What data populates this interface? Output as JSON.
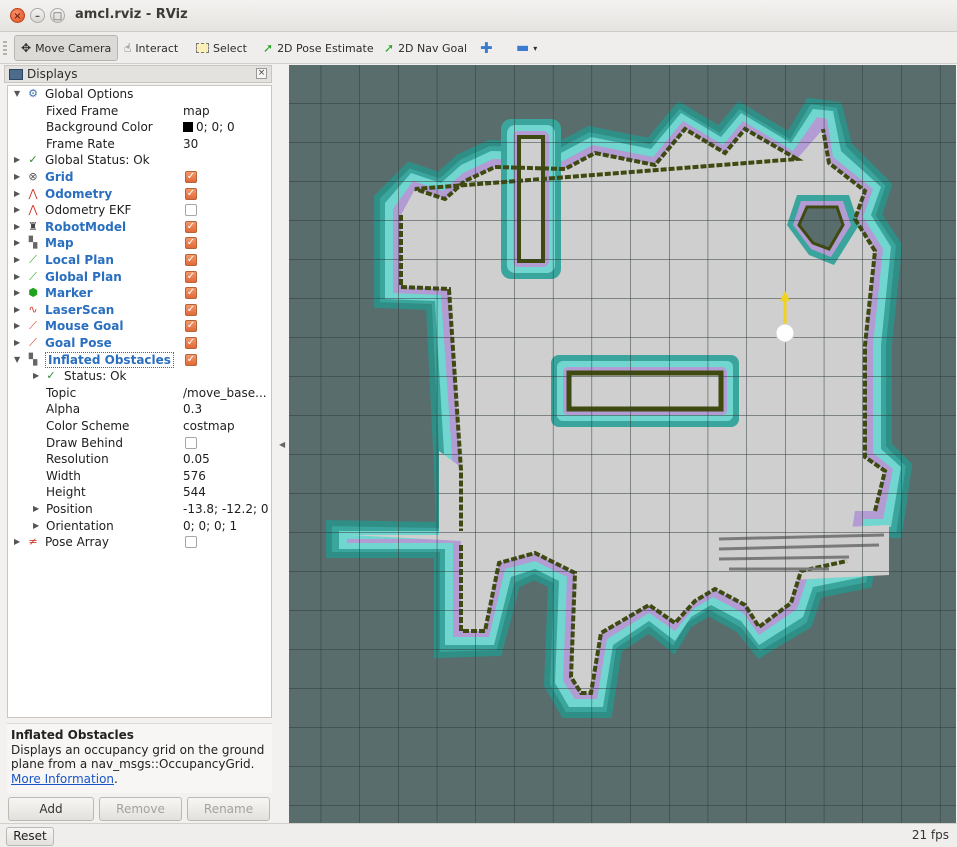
{
  "window": {
    "title": "amcl.rviz - RViz"
  },
  "toolbar": {
    "tools": [
      {
        "label": "Move Camera",
        "icon": "move-camera-icon"
      },
      {
        "label": "Interact",
        "icon": "hand-icon"
      },
      {
        "label": "Select",
        "icon": "select-icon"
      },
      {
        "label": "2D Pose Estimate",
        "icon": "pose-arrow-icon"
      },
      {
        "label": "2D Nav Goal",
        "icon": "goal-arrow-icon"
      }
    ]
  },
  "displays": {
    "title": "Displays",
    "rows": [
      {
        "label": "Global Options"
      },
      {
        "label": "Fixed Frame",
        "value": "map"
      },
      {
        "label": "Background Color",
        "value": "0; 0; 0"
      },
      {
        "label": "Frame Rate",
        "value": "30"
      },
      {
        "label": "Global Status: Ok"
      },
      {
        "label": "Grid",
        "checked": true
      },
      {
        "label": "Odometry",
        "checked": true
      },
      {
        "label": "Odometry EKF",
        "checked": false
      },
      {
        "label": "RobotModel",
        "checked": true
      },
      {
        "label": "Map",
        "checked": true
      },
      {
        "label": "Local Plan",
        "checked": true
      },
      {
        "label": "Global Plan",
        "checked": true
      },
      {
        "label": "Marker",
        "checked": true
      },
      {
        "label": "LaserScan",
        "checked": true
      },
      {
        "label": "Mouse Goal",
        "checked": true
      },
      {
        "label": "Goal Pose",
        "checked": true
      },
      {
        "label": "Inflated Obstacles",
        "checked": true
      },
      {
        "label": "Status: Ok"
      },
      {
        "label": "Topic",
        "value": "/move_base..."
      },
      {
        "label": "Alpha",
        "value": "0.3"
      },
      {
        "label": "Color Scheme",
        "value": "costmap"
      },
      {
        "label": "Draw Behind",
        "checked": false
      },
      {
        "label": "Resolution",
        "value": "0.05"
      },
      {
        "label": "Width",
        "value": "576"
      },
      {
        "label": "Height",
        "value": "544"
      },
      {
        "label": "Position",
        "value": "-13.8; -12.2; 0"
      },
      {
        "label": "Orientation",
        "value": "0; 0; 0; 1"
      },
      {
        "label": "Pose Array",
        "checked": false
      }
    ]
  },
  "description": {
    "title": "Inflated Obstacles",
    "text": "Displays an occupancy grid on the ground plane from a nav_msgs::OccupancyGrid.",
    "link": "More Information",
    "after_link": "."
  },
  "buttons": {
    "add": "Add",
    "remove": "Remove",
    "rename": "Rename"
  },
  "status": {
    "reset": "Reset",
    "fps": "21 fps"
  },
  "colors": {
    "view_background": "#5a6d6d",
    "free_space": "#cfcfcf",
    "wall": "#3f4a10",
    "inflation_inner": "#b39bd3",
    "inflation_outer": "#70d6cf",
    "inflation_edge": "#3aa59c",
    "checkbox_on": "#e8733f",
    "link": "#2a6fbf"
  }
}
